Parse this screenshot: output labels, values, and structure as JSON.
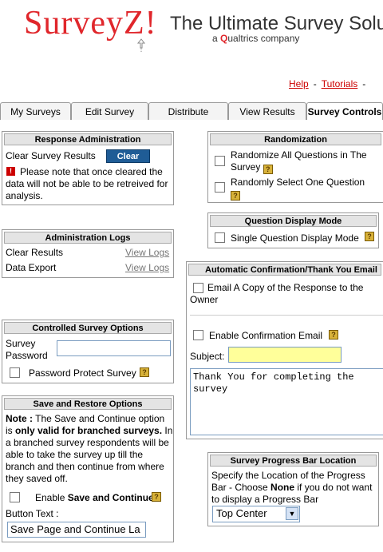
{
  "header": {
    "logo_text": "SurveyZ!",
    "tagline": "The Ultimate Survey Solu",
    "company_prefix": "a ",
    "company_q": "Q",
    "company_rest": "ualtrics company"
  },
  "top_links": {
    "help": "Help",
    "tutorials": "Tutorials",
    "sep": "-"
  },
  "tabs": [
    {
      "label": "My Surveys"
    },
    {
      "label": "Edit Survey"
    },
    {
      "label": "Distribute"
    },
    {
      "label": "View Results"
    },
    {
      "label": "Survey Controls"
    }
  ],
  "response_admin": {
    "title": "Response Administration",
    "clear_label": "Clear Survey Results",
    "clear_button": "Clear",
    "warning": "Please note that once cleared the data will not be able to be retreived for analysis."
  },
  "admin_logs": {
    "title": "Administration Logs",
    "rows": [
      {
        "label": "Clear Results",
        "link": "View Logs"
      },
      {
        "label": "Data Export",
        "link": "View Logs"
      }
    ]
  },
  "controlled": {
    "title": "Controlled Survey Options",
    "password_label": "Survey Password",
    "protect_label": "Password Protect Survey"
  },
  "save_restore": {
    "title": "Save and Restore Options",
    "note_label": "Note :",
    "note_a": " The Save and Continue option is ",
    "note_bold": "only valid for branched surveys.",
    "note_b": " In a branched survey respondents will be able to take the survey up till the branch and then continue from where they saved off.",
    "enable_prefix": "Enable ",
    "enable_bold": "Save and Continue",
    "button_text_label": "Button Text :",
    "button_text_value": "Save Page and Continue La"
  },
  "randomization": {
    "title": "Randomization",
    "opt1": "Randomize All Questions in The Survey",
    "opt2": "Randomly Select One Question"
  },
  "display_mode": {
    "title": "Question Display Mode",
    "opt": "Single Question Display Mode"
  },
  "confirmation": {
    "title": "Automatic Confirmation/Thank You Email",
    "email_copy": "Email A Copy of the Response to the Owner",
    "enable_email": "Enable Confirmation Email",
    "subject_label": "Subject:",
    "body": "Thank You for completing the survey"
  },
  "progress": {
    "title": "Survey Progress Bar Location",
    "desc_a": "Specify the Location of the Progress Bar - Choose ",
    "desc_bold": "None",
    "desc_b": " if you do not want to display a Progress Bar",
    "selected": "Top Center"
  },
  "colors": {
    "brand_red": "#e0262b",
    "accent_blue": "#1f5c96"
  },
  "help_icon": "?"
}
